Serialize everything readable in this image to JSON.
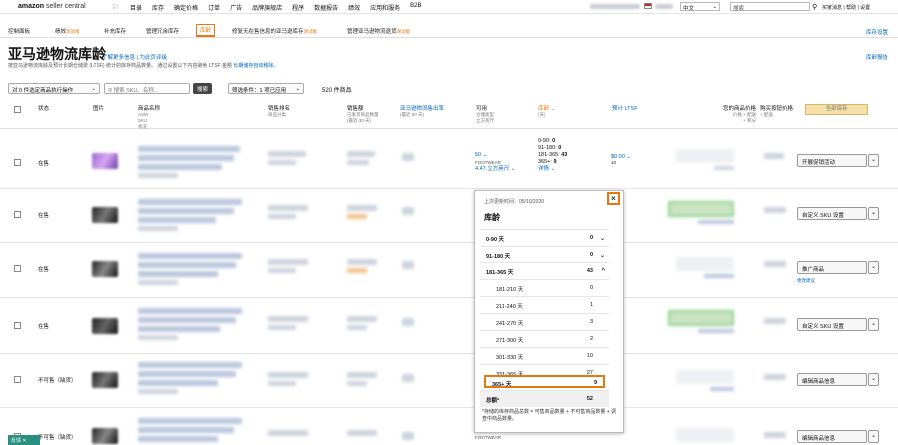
{
  "header": {
    "logo": "amazon",
    "logo_sub": "seller central",
    "nav": [
      "目录",
      "库存",
      "确定价格",
      "订单",
      "广告",
      "品牌旗舰店",
      "程序",
      "数据报告",
      "绩效",
      "应用和服务",
      "B2B"
    ],
    "language": "中文",
    "search_placeholder": "搜索",
    "links": "买家消息 | 帮助 | 设置"
  },
  "subnav": {
    "items": [
      {
        "label": "控制面板",
        "beta": ""
      },
      {
        "label": "绩效",
        "beta": "测试版"
      },
      {
        "label": "补充库存",
        "beta": ""
      },
      {
        "label": "管理冗余库存",
        "beta": ""
      },
      {
        "label": "库龄",
        "beta": ""
      },
      {
        "label": "修复无在售信息的亚马逊库存",
        "beta": "测试版"
      },
      {
        "label": "管理亚马逊物流退货",
        "beta": "测试版"
      }
    ],
    "right": "库存设置"
  },
  "page": {
    "title": "亚马逊物流库龄",
    "learn_more": "了解更多信息",
    "rate_page": "为此页评级",
    "report_link": "库龄报告",
    "description": "按亚马逊物流库龄及预计长期仓储费 (LTSF) 统计的库存商品数量。 通过设置以下内容避免 LTSF 金额",
    "description_link": "长期储存自动移除。"
  },
  "toolbar": {
    "bulk_action": "对 0 件选定商品执行操作",
    "search_placeholder": "搜索 SKU、名称...",
    "search_button": "搜索",
    "filter": "筛选条件：1 项已应用",
    "count": "520 件商品",
    "save_all": "全部保存"
  },
  "columns": {
    "status": "状态",
    "image": "图片",
    "product": "商品名称",
    "product_sub": "ASIN\nSKU\n状况",
    "rank": "销售排名",
    "rank_sub": "商品分类",
    "sales": "销售额",
    "sales_sub": "已发货商品数量\n(最近 30 天)",
    "sell_through": "亚马逊物流售出率",
    "sell_through_sub": "(最近 90 天)",
    "available": "可用",
    "available_sub": "仓储类型\n立方英尺",
    "age": "库龄",
    "age_sub": "(天)",
    "ltsf": "预计 LTSF",
    "my_price": "您的商品价格",
    "my_price_sub": "价格 + 配送\n+ 积分",
    "buybox": "购买按钮价格",
    "buybox_sub": "+ 配送"
  },
  "rows": [
    {
      "status": "在售",
      "avail": "50",
      "storage": "FOOTWEAR",
      "cubic": "4.47 立方英尺",
      "age": [
        [
          "0-90",
          "0"
        ],
        [
          "91-180",
          "0"
        ],
        [
          "181-365",
          "43"
        ],
        [
          "365+",
          "9"
        ]
      ],
      "details": "详情",
      "ltsf": "$0.00",
      "ltsf_sub": "10",
      "action": "开展促销活动",
      "sublink": ""
    },
    {
      "status": "在售",
      "action": "自定义 SKU 设置",
      "sublink": ""
    },
    {
      "status": "在售",
      "action": "推广商品",
      "sublink": "更改建议"
    },
    {
      "status": "在售",
      "action": "自定义 SKU 设置",
      "sublink": ""
    },
    {
      "status": "不可售（缺货）",
      "action": "编辑商品信息",
      "sublink": ""
    },
    {
      "status": "不可售（缺货）",
      "action": "编辑商品信息",
      "storage": "FOOTWEAR",
      "sublink": ""
    }
  ],
  "popover": {
    "updated": "上次更新时间：05/10/2020",
    "title": "库龄",
    "groups": [
      {
        "label": "0-90 天",
        "value": "0",
        "caret": "⌄"
      },
      {
        "label": "91-180 天",
        "value": "0",
        "caret": "⌄"
      },
      {
        "label": "181-365 天",
        "value": "43",
        "caret": "^"
      }
    ],
    "sub": [
      {
        "label": "181-210 天",
        "value": "0"
      },
      {
        "label": "211-240 天",
        "value": "1"
      },
      {
        "label": "241-270 天",
        "value": "3"
      },
      {
        "label": "271-300 天",
        "value": "2"
      },
      {
        "label": "301-330 天",
        "value": "10"
      },
      {
        "label": "331-365 天",
        "value": "27"
      }
    ],
    "over365": {
      "label": "365+ 天",
      "value": "9"
    },
    "total": {
      "label": "总额*",
      "value": "52"
    },
    "note": "*存储的库存商品总数 = 可售商品数量 + 不可售商品数量 + 调查中商品数量。",
    "close": "×"
  },
  "feedback": "反馈"
}
